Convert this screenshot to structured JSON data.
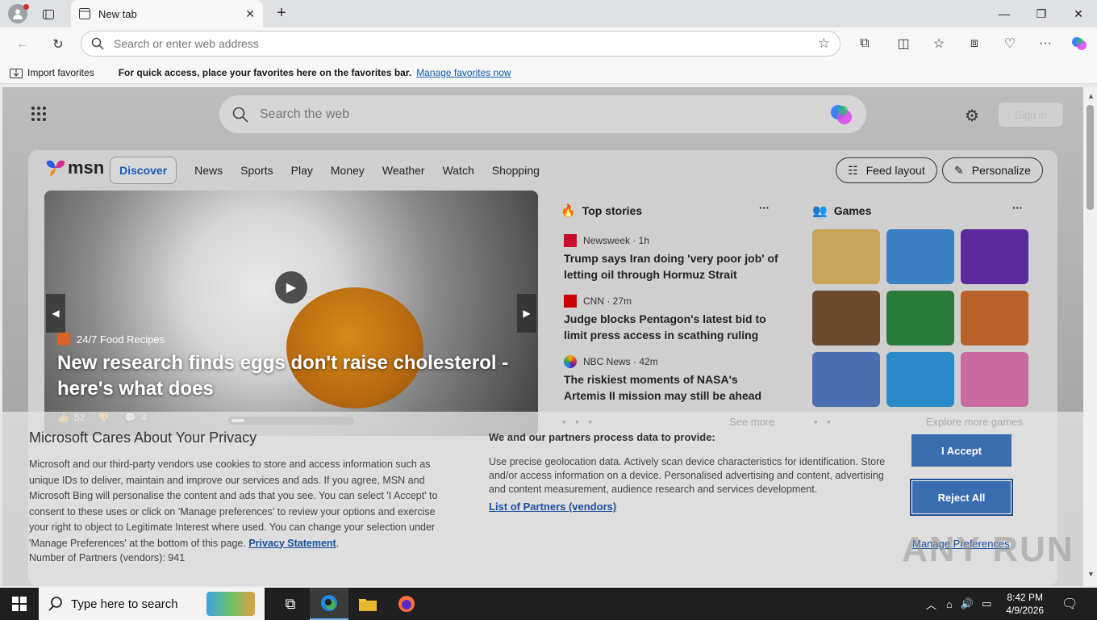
{
  "browser": {
    "tab_title": "New tab",
    "address_placeholder": "Search or enter web address",
    "favorites": {
      "import_label": "Import favorites",
      "message": "For quick access, place your favorites here on the favorites bar.",
      "manage_link": "Manage favorites now"
    }
  },
  "msn": {
    "search_placeholder": "Search the web",
    "sign_in": "Sign in",
    "logo": "msn",
    "nav": [
      "Discover",
      "News",
      "Sports",
      "Play",
      "Money",
      "Weather",
      "Watch",
      "Shopping"
    ],
    "feed_layout": "Feed layout",
    "personalize": "Personalize",
    "hero": {
      "source": "24/7 Food Recipes",
      "title": "New research finds eggs don't raise cholesterol - here's what does",
      "likes": "52",
      "comments": "4"
    },
    "top_stories": {
      "title": "Top stories",
      "see_more": "See more",
      "items": [
        {
          "source": "Newsweek · 1h",
          "headline": "Trump says Iran doing 'very poor job' of letting oil through Hormuz Strait"
        },
        {
          "source": "CNN · 27m",
          "headline": "Judge blocks Pentagon's latest bid to limit press access in scathing ruling"
        },
        {
          "source": "NBC News · 42m",
          "headline": "The riskiest moments of NASA's Artemis II mission may still be ahead"
        }
      ]
    },
    "games": {
      "title": "Games",
      "explore": "Explore more games",
      "tile_colors": [
        "#c9a35a",
        "#3a7fc1",
        "#5b2a9c",
        "#6b4a2e",
        "#2a7a3a",
        "#b8622a",
        "#4a6fb0",
        "#2a8ac9",
        "#c96aa0"
      ]
    }
  },
  "privacy": {
    "title": "Microsoft Cares About Your Privacy",
    "body": "Microsoft and our third-party vendors use cookies to store and access information such as unique IDs to deliver, maintain and improve our services and ads. If you agree, MSN and Microsoft Bing will personalise the content and ads that you see. You can select 'I Accept' to consent to these uses or click on 'Manage preferences' to review your options and exercise your right to object to Legitimate Interest where used. You can change your selection under 'Manage Preferences' at the bottom of this page.",
    "privacy_link": "Privacy Statement",
    "partners_count": "Number of Partners (vendors): 941",
    "data_title": "We and our partners process data to provide:",
    "data_body": "Use precise geolocation data. Actively scan device characteristics for identification. Store and/or access information on a device. Personalised advertising and content, advertising and content measurement, audience research and services development.",
    "partners_link": "List of Partners (vendors)",
    "accept": "I Accept",
    "reject": "Reject All",
    "manage": "Manage Preferences"
  },
  "watermark": "ANY RUN",
  "taskbar": {
    "search_placeholder": "Type here to search",
    "time": "8:42 PM",
    "date": "4/9/2026"
  }
}
